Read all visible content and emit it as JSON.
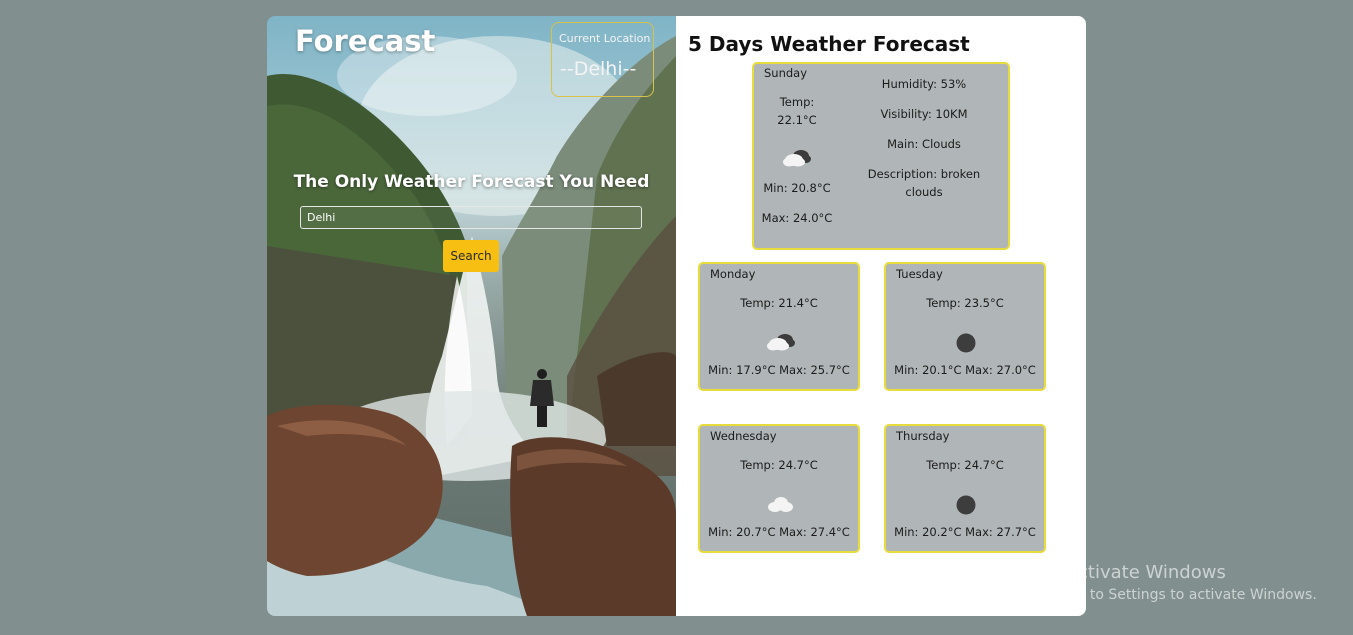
{
  "hero": {
    "title": "Forecast",
    "location_caption": "Current Location",
    "location_value": "--Delhi--",
    "tagline": "The Only Weather Forecast You Need",
    "search_value": "Delhi",
    "search_button": "Search"
  },
  "forecast": {
    "title": "5 Days Weather Forecast",
    "today": {
      "day": "Sunday",
      "temp_label": "Temp:",
      "temp_value": "22.1°C",
      "icon": "broken-clouds-icon",
      "min": "Min: 20.8°C",
      "max": "Max: 24.0°C",
      "humidity": "Humidity: 53%",
      "visibility": "Visibility: 10KM",
      "main": "Main: Clouds",
      "description_line1": "Description: broken",
      "description_line2": "clouds"
    },
    "days": [
      {
        "day": "Monday",
        "temp": "Temp: 21.4°C",
        "icon": "broken-clouds-icon",
        "minmax": "Min: 17.9°C  Max: 25.7°C"
      },
      {
        "day": "Tuesday",
        "temp": "Temp: 23.5°C",
        "icon": "dark-circle-icon",
        "minmax": "Min: 20.1°C  Max: 27.0°C"
      },
      {
        "day": "Wednesday",
        "temp": "Temp: 24.7°C",
        "icon": "cloud-icon",
        "minmax": "Min: 20.7°C  Max: 27.4°C"
      },
      {
        "day": "Thursday",
        "temp": "Temp: 24.7°C",
        "icon": "dark-circle-icon",
        "minmax": "Min: 20.2°C  Max: 27.7°C"
      }
    ]
  },
  "watermark": {
    "line1": "Activate Windows",
    "line2": "Go to Settings to activate Windows."
  },
  "colors": {
    "background": "#818f8f",
    "card": "#b0b6b7",
    "card_border": "#e6dc3c",
    "button": "#f6bf11"
  }
}
